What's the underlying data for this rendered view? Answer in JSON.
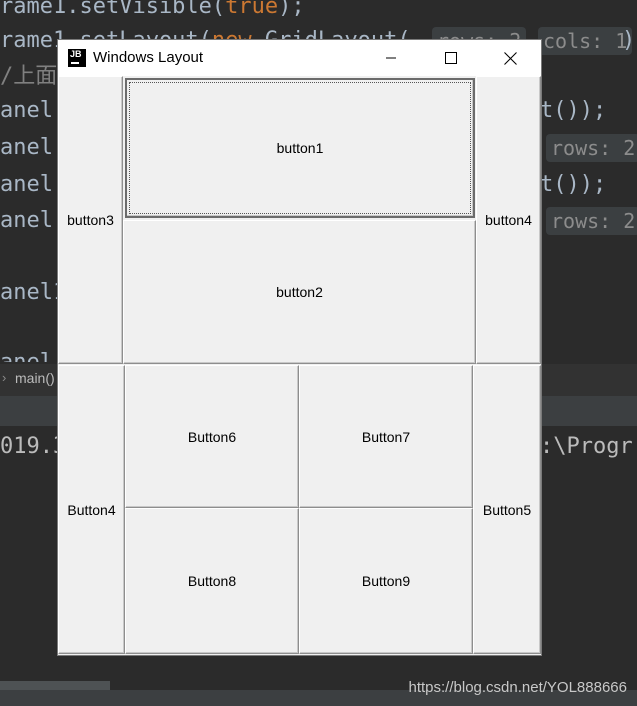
{
  "ide": {
    "lines": [
      {
        "pre": "rame1.setVisible(",
        "kw": "true",
        "post": ");"
      },
      {
        "pre": "rame1.setLayout(",
        "kw": "new",
        "post": " GridLayout("
      },
      {
        "comment": "/上面"
      },
      {
        "pre": "anel",
        "post": ""
      },
      {
        "pre": "anel",
        "post": ""
      },
      {
        "pre": "anel",
        "post": ""
      },
      {
        "pre": "anel",
        "post": ""
      },
      {
        "pre": "anel1",
        "post": ""
      },
      {
        "pre": "anel",
        "post": ""
      }
    ],
    "hints": {
      "rows_label": "rows:",
      "rows_value": "2",
      "cols_label": "cols:",
      "cols_value": "1",
      "close_paren": ")"
    },
    "right_fragments": [
      "t());",
      "t());"
    ],
    "breadcrumb": "main()",
    "console_left": "019.3",
    "console_right": ":\\Progr"
  },
  "window": {
    "title": "Windows Layout",
    "icon_text": "JB"
  },
  "buttons": {
    "button1": "button1",
    "button2": "button2",
    "button3": "button3",
    "button4_top": "button4",
    "button4_bottom": "Button4",
    "button5": "Button5",
    "button6": "Button6",
    "button7": "Button7",
    "button8": "Button8",
    "button9": "Button9"
  },
  "watermark": "https://blog.csdn.net/YOL888666"
}
